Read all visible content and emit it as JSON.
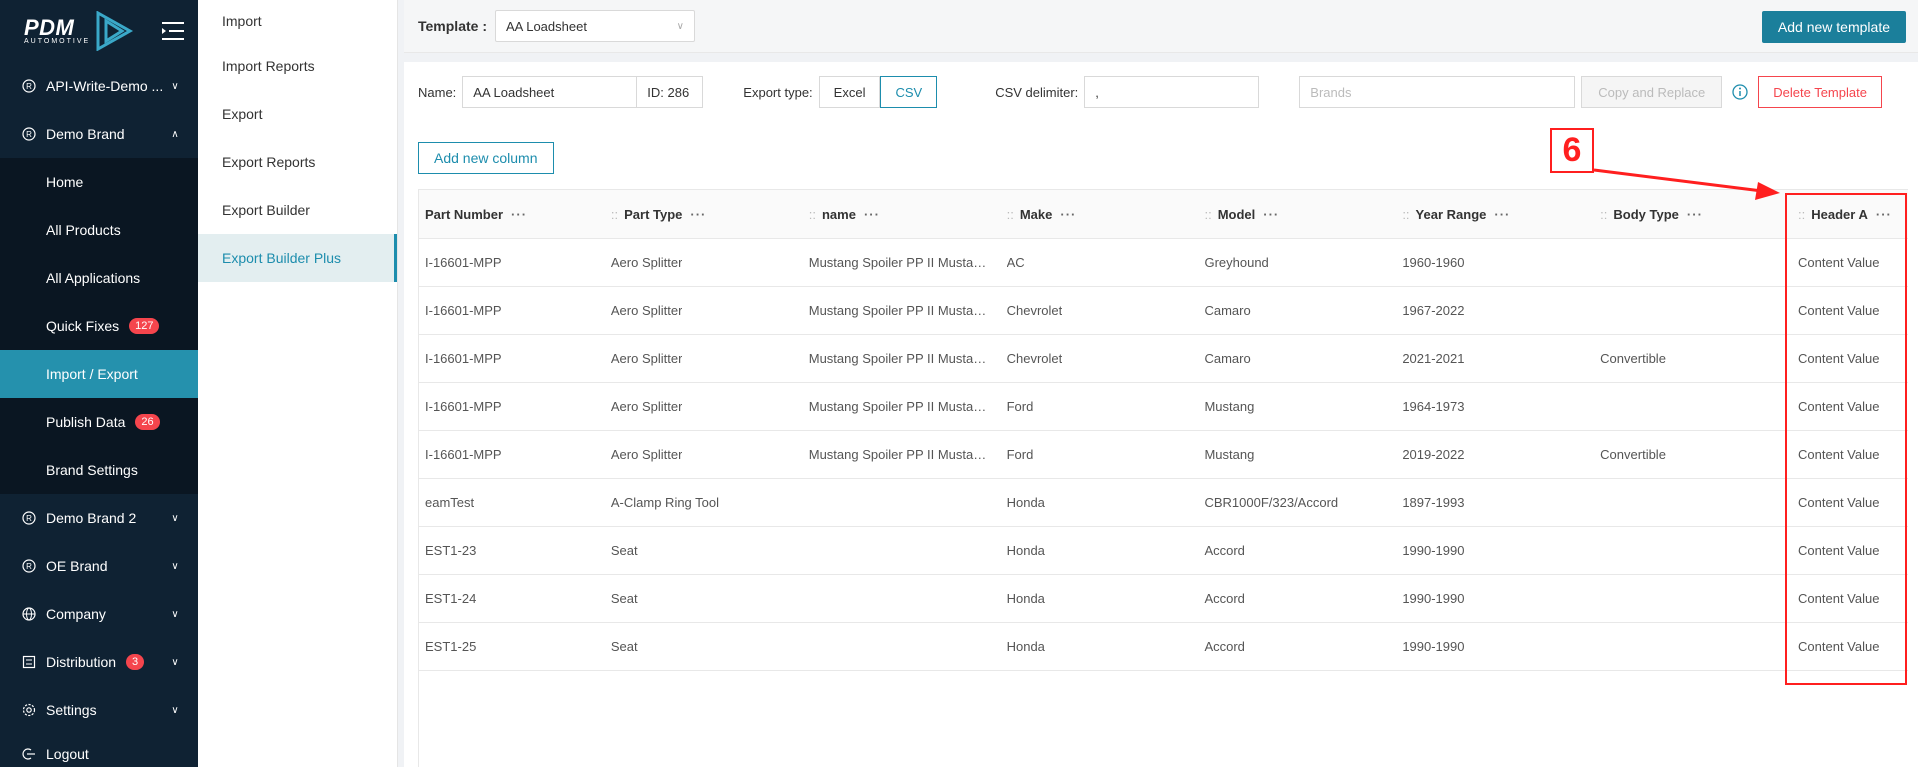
{
  "brand": {
    "name": "PDM",
    "sub": "AUTOMOTIVE"
  },
  "sidebar": {
    "items": [
      {
        "label": "API-Write-Demo ...",
        "icon": "registered-icon"
      },
      {
        "label": "Demo Brand",
        "icon": "registered-icon"
      },
      {
        "label": "Demo Brand 2",
        "icon": "registered-icon"
      },
      {
        "label": "OE Brand",
        "icon": "registered-icon"
      },
      {
        "label": "Company",
        "icon": "globe-icon"
      },
      {
        "label": "Distribution",
        "icon": "distribution-icon",
        "badge": "3"
      },
      {
        "label": "Settings",
        "icon": "gear-icon"
      },
      {
        "label": "Logout",
        "icon": "logout-icon"
      }
    ],
    "sub_items": [
      {
        "label": "Home"
      },
      {
        "label": "All Products"
      },
      {
        "label": "All Applications"
      },
      {
        "label": "Quick Fixes",
        "badge": "127"
      },
      {
        "label": "Import / Export"
      },
      {
        "label": "Publish Data",
        "badge": "26"
      },
      {
        "label": "Brand Settings"
      }
    ]
  },
  "submenu": {
    "items": [
      "Import",
      "Import Reports",
      "Export",
      "Export Reports",
      "Export Builder",
      "Export Builder Plus"
    ]
  },
  "topbar": {
    "template_label": "Template :",
    "template_value": "AA Loadsheet",
    "add_template_label": "Add new template"
  },
  "form": {
    "name_label": "Name:",
    "name_value": "AA Loadsheet",
    "id_value": "ID: 286",
    "export_type_label": "Export type:",
    "export_types": [
      "Excel",
      "CSV"
    ],
    "csv_delimiter_label": "CSV delimiter:",
    "csv_delimiter_value": ",",
    "brands_placeholder": "Brands",
    "copy_replace_label": "Copy and Replace",
    "delete_label": "Delete Template"
  },
  "add_column_label": "Add new column",
  "table": {
    "columns": [
      "Part Number",
      "Part Type",
      "name",
      "Make",
      "Model",
      "Year Range",
      "Body Type",
      "Header A"
    ],
    "rows": [
      [
        "I-16601-MPP",
        "Aero Splitter",
        "Mustang Spoiler PP II Mustang",
        "AC",
        "Greyhound",
        "1960-1960",
        "",
        "Content Value"
      ],
      [
        "I-16601-MPP",
        "Aero Splitter",
        "Mustang Spoiler PP II Mustang",
        "Chevrolet",
        "Camaro",
        "1967-2022",
        "",
        "Content Value"
      ],
      [
        "I-16601-MPP",
        "Aero Splitter",
        "Mustang Spoiler PP II Mustang",
        "Chevrolet",
        "Camaro",
        "2021-2021",
        "Convertible",
        "Content Value"
      ],
      [
        "I-16601-MPP",
        "Aero Splitter",
        "Mustang Spoiler PP II Mustang",
        "Ford",
        "Mustang",
        "1964-1973",
        "",
        "Content Value"
      ],
      [
        "I-16601-MPP",
        "Aero Splitter",
        "Mustang Spoiler PP II Mustang",
        "Ford",
        "Mustang",
        "2019-2022",
        "Convertible",
        "Content Value"
      ],
      [
        "eamTest",
        "A-Clamp Ring Tool",
        "",
        "Honda",
        "CBR1000F/323/Accord",
        "1897-1993",
        "",
        "Content Value"
      ],
      [
        "EST1-23",
        "Seat",
        "",
        "Honda",
        "Accord",
        "1990-1990",
        "",
        "Content Value"
      ],
      [
        "EST1-24",
        "Seat",
        "",
        "Honda",
        "Accord",
        "1990-1990",
        "",
        "Content Value"
      ],
      [
        "EST1-25",
        "Seat",
        "",
        "Honda",
        "Accord",
        "1990-1990",
        "",
        "Content Value"
      ]
    ]
  },
  "annotation": {
    "number": "6",
    "color": "#ff1f1f"
  }
}
